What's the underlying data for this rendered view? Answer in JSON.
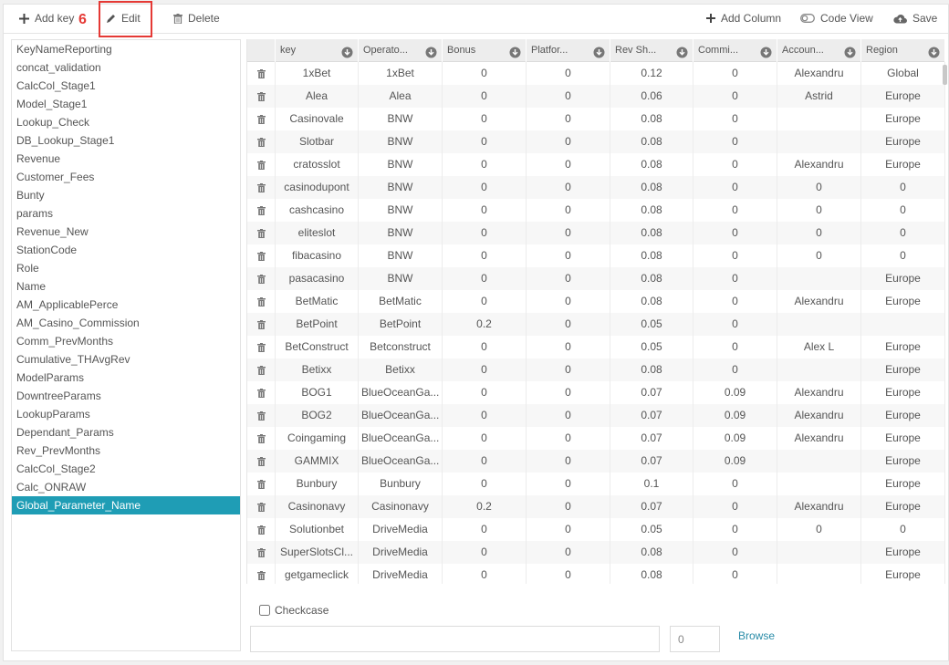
{
  "toolbar": {
    "add_key": "Add key",
    "edit": "Edit",
    "delete": "Delete",
    "add_column": "Add Column",
    "code_view": "Code View",
    "save": "Save",
    "annotation_number": "6",
    "annotation_color": "#e53935"
  },
  "list": {
    "items": [
      "KeyNameReporting",
      "concat_validation",
      "CalcCol_Stage1",
      "Model_Stage1",
      "Lookup_Check",
      "DB_Lookup_Stage1",
      "Revenue",
      "Customer_Fees",
      "Bunty",
      "params",
      "Revenue_New",
      "StationCode",
      "Role",
      "Name",
      "AM_ApplicablePerce",
      "AM_Casino_Commission",
      "Comm_PrevMonths",
      "Cumulative_THAvgRev",
      "ModelParams",
      "DowntreeParams",
      "LookupParams",
      "Dependant_Params",
      "Rev_PrevMonths",
      "CalcCol_Stage2",
      "Calc_ONRAW",
      "Global_Parameter_Name"
    ],
    "selected_index": 25,
    "selected_color": "#1f9db5"
  },
  "grid": {
    "columns": [
      "key",
      "Operato...",
      "Bonus",
      "Platfor...",
      "Rev Sh...",
      "Commi...",
      "Accoun...",
      "Region"
    ],
    "rows": [
      [
        "1xBet",
        "1xBet",
        "0",
        "0",
        "0.12",
        "0",
        "Alexandru",
        "Global"
      ],
      [
        "Alea",
        "Alea",
        "0",
        "0",
        "0.06",
        "0",
        "Astrid",
        "Europe"
      ],
      [
        "Casinovale",
        "BNW",
        "0",
        "0",
        "0.08",
        "0",
        "",
        "Europe"
      ],
      [
        "Slotbar",
        "BNW",
        "0",
        "0",
        "0.08",
        "0",
        "",
        "Europe"
      ],
      [
        "cratosslot",
        "BNW",
        "0",
        "0",
        "0.08",
        "0",
        "Alexandru",
        "Europe"
      ],
      [
        "casinodupont",
        "BNW",
        "0",
        "0",
        "0.08",
        "0",
        "0",
        "0"
      ],
      [
        "cashcasino",
        "BNW",
        "0",
        "0",
        "0.08",
        "0",
        "0",
        "0"
      ],
      [
        "eliteslot",
        "BNW",
        "0",
        "0",
        "0.08",
        "0",
        "0",
        "0"
      ],
      [
        "fibacasino",
        "BNW",
        "0",
        "0",
        "0.08",
        "0",
        "0",
        "0"
      ],
      [
        "pasacasino",
        "BNW",
        "0",
        "0",
        "0.08",
        "0",
        "",
        "Europe"
      ],
      [
        "BetMatic",
        "BetMatic",
        "0",
        "0",
        "0.08",
        "0",
        "Alexandru",
        "Europe"
      ],
      [
        "BetPoint",
        "BetPoint",
        "0.2",
        "0",
        "0.05",
        "0",
        "",
        ""
      ],
      [
        "BetConstruct",
        "Betconstruct",
        "0",
        "0",
        "0.05",
        "0",
        "Alex L",
        "Europe"
      ],
      [
        "Betixx",
        "Betixx",
        "0",
        "0",
        "0.08",
        "0",
        "",
        "Europe"
      ],
      [
        "BOG1",
        "BlueOceanGa...",
        "0",
        "0",
        "0.07",
        "0.09",
        "Alexandru",
        "Europe"
      ],
      [
        "BOG2",
        "BlueOceanGa...",
        "0",
        "0",
        "0.07",
        "0.09",
        "Alexandru",
        "Europe"
      ],
      [
        "Coingaming",
        "BlueOceanGa...",
        "0",
        "0",
        "0.07",
        "0.09",
        "Alexandru",
        "Europe"
      ],
      [
        "GAMMIX",
        "BlueOceanGa...",
        "0",
        "0",
        "0.07",
        "0.09",
        "",
        "Europe"
      ],
      [
        "Bunbury",
        "Bunbury",
        "0",
        "0",
        "0.1",
        "0",
        "",
        "Europe"
      ],
      [
        "Casinonavy",
        "Casinonavy",
        "0.2",
        "0",
        "0.07",
        "0",
        "Alexandru",
        "Europe"
      ],
      [
        "Solutionbet",
        "DriveMedia",
        "0",
        "0",
        "0.05",
        "0",
        "0",
        "0"
      ],
      [
        "SuperSlotsCl...",
        "DriveMedia",
        "0",
        "0",
        "0.08",
        "0",
        "",
        "Europe"
      ],
      [
        "getgameclick",
        "DriveMedia",
        "0",
        "0",
        "0.08",
        "0",
        "",
        "Europe"
      ]
    ]
  },
  "footer": {
    "checkcase_label": "Checkcase",
    "text_value": "",
    "number_value": "0",
    "browse_label": "Browse"
  }
}
